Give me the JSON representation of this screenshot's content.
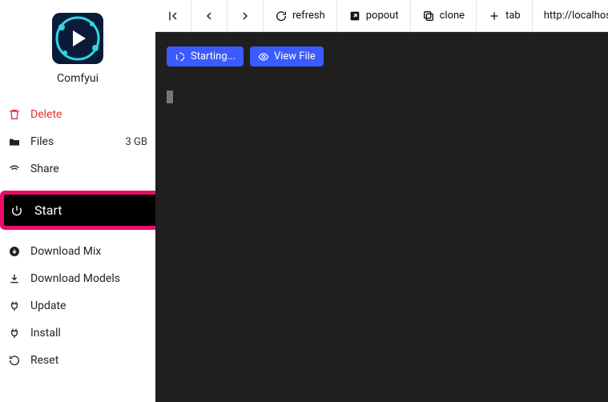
{
  "app": {
    "title": "Comfyui"
  },
  "sidebar": {
    "delete": {
      "label": "Delete"
    },
    "files": {
      "label": "Files",
      "size": "3 GB"
    },
    "share": {
      "label": "Share"
    },
    "start": {
      "label": "Start"
    },
    "download_mix": {
      "label": "Download Mix"
    },
    "download_models": {
      "label": "Download Models"
    },
    "update": {
      "label": "Update"
    },
    "install": {
      "label": "Install"
    },
    "reset": {
      "label": "Reset"
    }
  },
  "toolbar": {
    "refresh": "refresh",
    "popout": "popout",
    "clone": "clone",
    "tab": "tab",
    "url": "http://localhost"
  },
  "terminal": {
    "starting_btn": "Starting...",
    "view_file_btn": "View File"
  }
}
